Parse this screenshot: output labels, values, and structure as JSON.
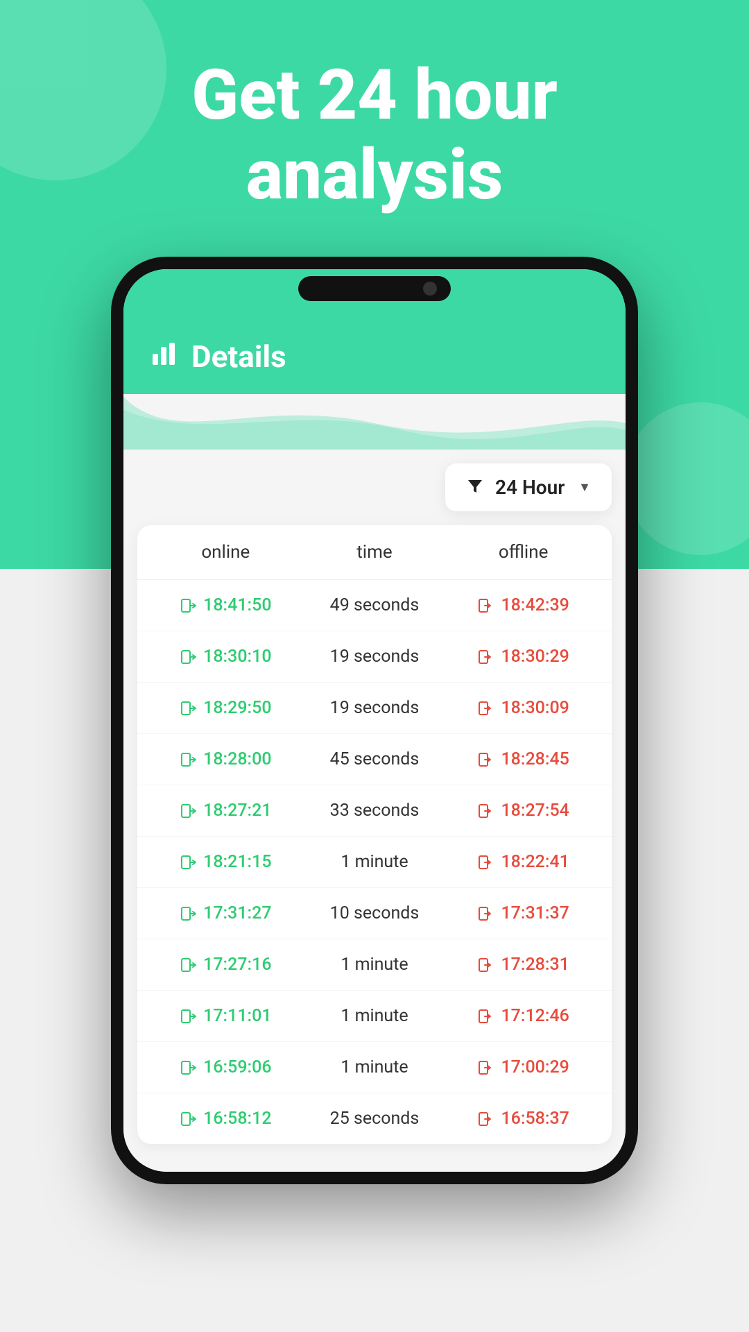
{
  "hero": {
    "title_line1": "Get 24 hour",
    "title_line2": "analysis"
  },
  "screen": {
    "header": {
      "icon": "📊",
      "title": "Details"
    },
    "filter": {
      "label": "24 Hour",
      "icon": "▼"
    },
    "table": {
      "headers": [
        "online",
        "time",
        "offline"
      ],
      "rows": [
        {
          "online": "18:41:50",
          "time": "49 seconds",
          "offline": "18:42:39"
        },
        {
          "online": "18:30:10",
          "time": "19 seconds",
          "offline": "18:30:29"
        },
        {
          "online": "18:29:50",
          "time": "19 seconds",
          "offline": "18:30:09"
        },
        {
          "online": "18:28:00",
          "time": "45 seconds",
          "offline": "18:28:45"
        },
        {
          "online": "18:27:21",
          "time": "33 seconds",
          "offline": "18:27:54"
        },
        {
          "online": "18:21:15",
          "time": "1 minute",
          "offline": "18:22:41"
        },
        {
          "online": "17:31:27",
          "time": "10 seconds",
          "offline": "17:31:37"
        },
        {
          "online": "17:27:16",
          "time": "1 minute",
          "offline": "17:28:31"
        },
        {
          "online": "17:11:01",
          "time": "1 minute",
          "offline": "17:12:46"
        },
        {
          "online": "16:59:06",
          "time": "1 minute",
          "offline": "17:00:29"
        },
        {
          "online": "16:58:12",
          "time": "25 seconds",
          "offline": "16:58:37"
        }
      ]
    }
  }
}
